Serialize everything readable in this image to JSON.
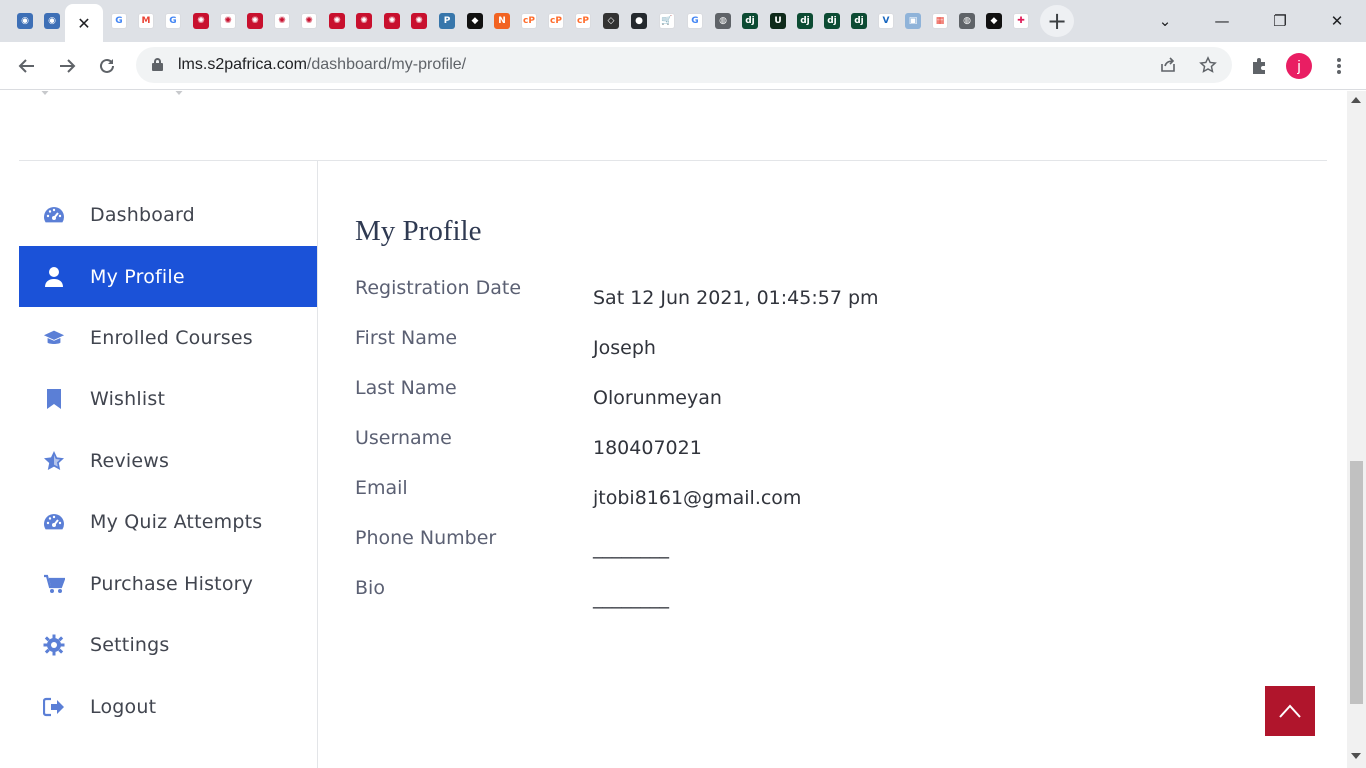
{
  "browser": {
    "tabs": [
      {
        "icon": "site-icon",
        "color": "#3d6fb6",
        "glyph": "◉"
      },
      {
        "icon": "site-icon",
        "color": "#3d6fb6",
        "glyph": "◉"
      },
      {
        "icon": "close-icon",
        "active": true
      },
      {
        "icon": "google-icon",
        "color": "#ffffff",
        "glyph": "G",
        "fg": "#4285f4"
      },
      {
        "icon": "gmail-icon",
        "color": "#ffffff",
        "glyph": "M",
        "fg": "#ea4335"
      },
      {
        "icon": "google-icon",
        "color": "#ffffff",
        "glyph": "G",
        "fg": "#4285f4"
      },
      {
        "icon": "gear-flower-icon",
        "color": "#c8102e",
        "glyph": "✺"
      },
      {
        "icon": "gear-flower-icon",
        "color": "#ffffff",
        "glyph": "✺",
        "fg": "#c8102e"
      },
      {
        "icon": "gear-flower-icon",
        "color": "#c8102e",
        "glyph": "✺"
      },
      {
        "icon": "gear-flower-icon",
        "color": "#ffffff",
        "glyph": "✺",
        "fg": "#c8102e"
      },
      {
        "icon": "gear-flower-icon",
        "color": "#ffffff",
        "glyph": "✺",
        "fg": "#c8102e"
      },
      {
        "icon": "gear-flower-icon",
        "color": "#c8102e",
        "glyph": "✺"
      },
      {
        "icon": "gear-flower-icon",
        "color": "#c8102e",
        "glyph": "✺"
      },
      {
        "icon": "gear-flower-icon",
        "color": "#c8102e",
        "glyph": "✺"
      },
      {
        "icon": "gear-flower-icon",
        "color": "#c8102e",
        "glyph": "✺"
      },
      {
        "icon": "python-icon",
        "color": "#3776ab",
        "glyph": "P"
      },
      {
        "icon": "bird-icon",
        "color": "#111111",
        "glyph": "◆"
      },
      {
        "icon": "n-icon",
        "color": "#f26322",
        "glyph": "N"
      },
      {
        "icon": "cpanel-icon",
        "color": "#ffffff",
        "glyph": "cP",
        "fg": "#ff6c2c"
      },
      {
        "icon": "cpanel-icon",
        "color": "#ffffff",
        "glyph": "cP",
        "fg": "#ff6c2c"
      },
      {
        "icon": "cpanel-icon",
        "color": "#ffffff",
        "glyph": "cP",
        "fg": "#ff6c2c"
      },
      {
        "icon": "codepen-icon",
        "color": "#333333",
        "glyph": "◇"
      },
      {
        "icon": "github-icon",
        "color": "#24292e",
        "glyph": "●"
      },
      {
        "icon": "cart-icon",
        "color": "#ffffff",
        "glyph": "🛒",
        "fg": "#555555"
      },
      {
        "icon": "google-icon",
        "color": "#ffffff",
        "glyph": "G",
        "fg": "#4285f4"
      },
      {
        "icon": "globe-icon",
        "color": "#5f6368",
        "glyph": "◍"
      },
      {
        "icon": "django-icon",
        "color": "#0c4b33",
        "glyph": "dj"
      },
      {
        "icon": "u-icon",
        "color": "#0f2a1a",
        "glyph": "U"
      },
      {
        "icon": "django-icon",
        "color": "#0c4b33",
        "glyph": "dj"
      },
      {
        "icon": "django-icon",
        "color": "#0c4b33",
        "glyph": "dj"
      },
      {
        "icon": "django-icon",
        "color": "#0c4b33",
        "glyph": "dj"
      },
      {
        "icon": "vuetify-icon",
        "color": "#ffffff",
        "glyph": "V",
        "fg": "#1867c0"
      },
      {
        "icon": "square-icon",
        "color": "#8fb3d9",
        "glyph": "▣"
      },
      {
        "icon": "grid-icon",
        "color": "#ffffff",
        "glyph": "▦",
        "fg": "#e94235"
      },
      {
        "icon": "globe-icon",
        "color": "#5f6368",
        "glyph": "◍"
      },
      {
        "icon": "bird-icon",
        "color": "#111111",
        "glyph": "◆"
      },
      {
        "icon": "slack-icon",
        "color": "#ffffff",
        "glyph": "✚",
        "fg": "#e01e5a"
      }
    ],
    "new_tab": "+",
    "window_controls": {
      "minimize": "—",
      "restore": "❐",
      "close": "✕",
      "tab_search": "⌄"
    },
    "url_domain": "lms.s2pafrica.com",
    "url_path": "/dashboard/my-profile/",
    "profile_initial": "j"
  },
  "sidebar": {
    "items": [
      {
        "label": "Dashboard",
        "icon": "dashboard-icon",
        "active": false
      },
      {
        "label": "My Profile",
        "icon": "user-icon",
        "active": true
      },
      {
        "label": "Enrolled Courses",
        "icon": "graduation-cap-icon",
        "active": false
      },
      {
        "label": "Wishlist",
        "icon": "bookmark-icon",
        "active": false
      },
      {
        "label": "Reviews",
        "icon": "star-icon",
        "active": false
      },
      {
        "label": "My Quiz Attempts",
        "icon": "dashboard-icon",
        "active": false
      },
      {
        "label": "Purchase History",
        "icon": "cart-icon",
        "active": false
      },
      {
        "label": "Settings",
        "icon": "gear-icon",
        "active": false
      },
      {
        "label": "Logout",
        "icon": "logout-icon",
        "active": false
      }
    ],
    "icon_color": "#5b7fd6",
    "active_color": "#1b52d8"
  },
  "profile": {
    "title": "My Profile",
    "rows": [
      {
        "label": "Registration Date",
        "value": "Sat 12 Jun 2021, 01:45:57 pm"
      },
      {
        "label": "First Name",
        "value": "Joseph"
      },
      {
        "label": "Last Name",
        "value": "Olorunmeyan"
      },
      {
        "label": "Username",
        "value": "180407021"
      },
      {
        "label": "Email",
        "value": "jtobi8161@gmail.com"
      },
      {
        "label": "Phone Number",
        "value": "________"
      },
      {
        "label": "Bio",
        "value": "________"
      }
    ]
  },
  "back_to_top": {
    "icon": "chevron-up-icon",
    "color": "#b0152c"
  }
}
